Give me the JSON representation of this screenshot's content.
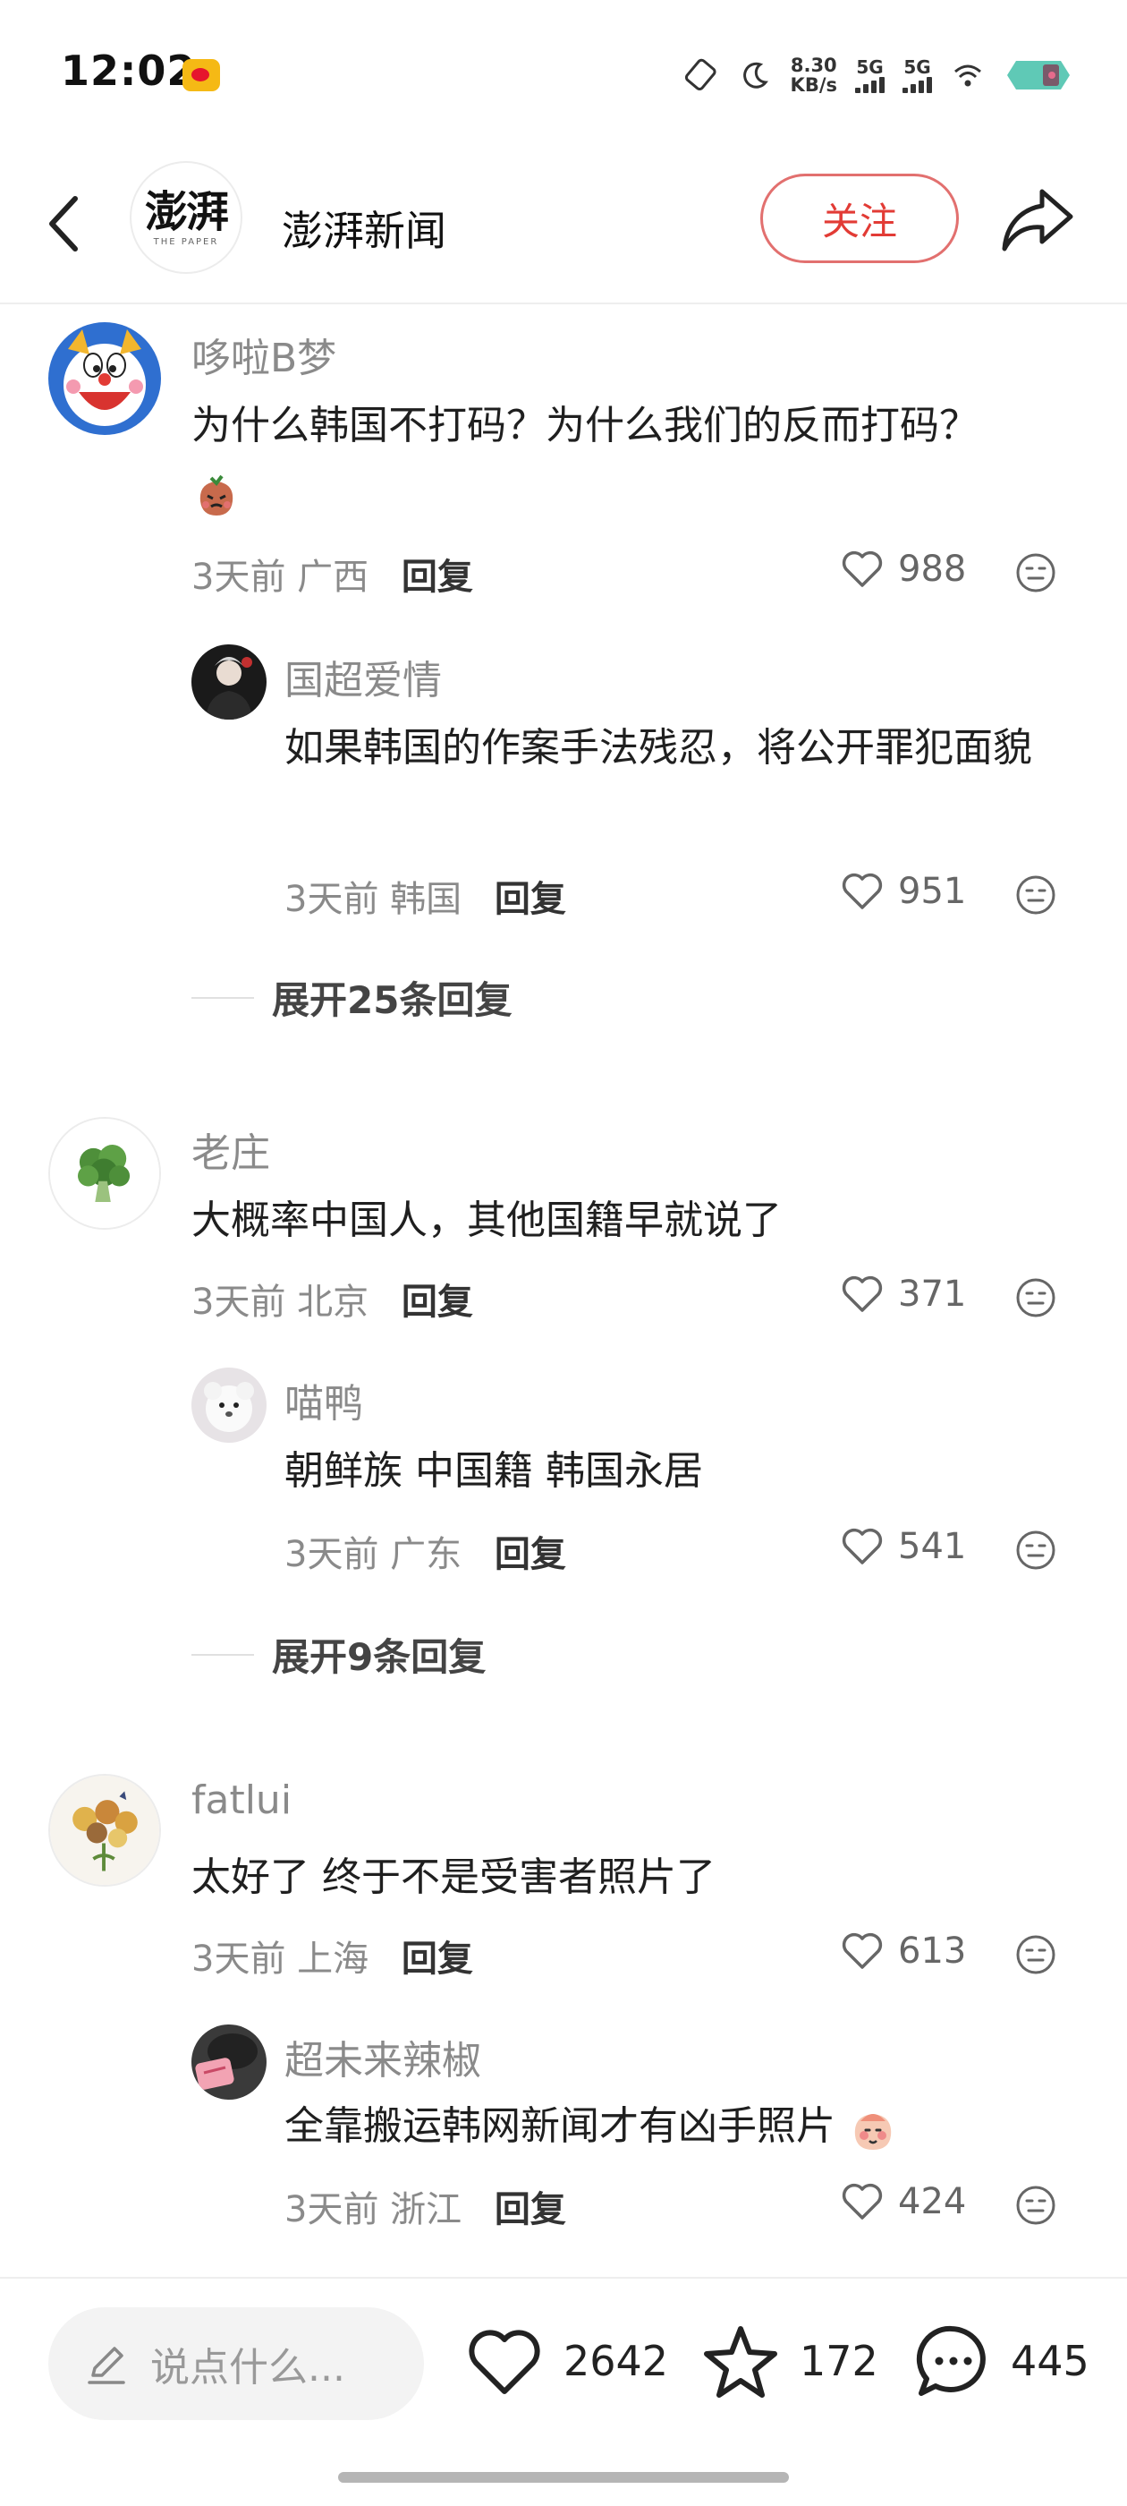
{
  "status_bar": {
    "time": "12:02",
    "net_speed_value": "8.30",
    "net_speed_unit": "KB/s",
    "sim1_label": "5G",
    "sim2_label": "5G"
  },
  "header": {
    "account_name": "澎湃新闻",
    "logo_text": "澎湃",
    "logo_subtitle": "THE PAPER",
    "follow_label": "关注"
  },
  "comments": [
    {
      "user": "哆啦B梦",
      "text": "为什么韩国不打码？为什么我们的反而打码？",
      "time": "3天前",
      "location": "广西",
      "reply_label": "回复",
      "likes": "988",
      "replies": [
        {
          "user": "国超爱情",
          "text": "如果韩国的作案手法残忍，将公开罪犯面貌",
          "time": "3天前",
          "location": "韩国",
          "reply_label": "回复",
          "likes": "951"
        }
      ],
      "expand_label": "展开25条回复"
    },
    {
      "user": "老庄",
      "text": "大概率中国人，其他国籍早就说了",
      "time": "3天前",
      "location": "北京",
      "reply_label": "回复",
      "likes": "371",
      "replies": [
        {
          "user": "喵鸭",
          "text": "朝鲜族 中国籍 韩国永居",
          "time": "3天前",
          "location": "广东",
          "reply_label": "回复",
          "likes": "541"
        }
      ],
      "expand_label": "展开9条回复"
    },
    {
      "user": "fatlui",
      "text": "太好了 终于不是受害者照片了",
      "time": "3天前",
      "location": "上海",
      "reply_label": "回复",
      "likes": "613",
      "replies": [
        {
          "user": "超未来辣椒",
          "text": "全靠搬运韩网新闻才有凶手照片",
          "time": "3天前",
          "location": "浙江",
          "reply_label": "回复",
          "likes": "424"
        }
      ]
    }
  ],
  "bottom_bar": {
    "input_placeholder": "说点什么...",
    "like_count": "2642",
    "favorite_count": "172",
    "comment_count": "445"
  },
  "colors": {
    "accent_red": "#e23b35",
    "follow_border": "#e2706f",
    "meta_gray": "#8a8a8a"
  }
}
